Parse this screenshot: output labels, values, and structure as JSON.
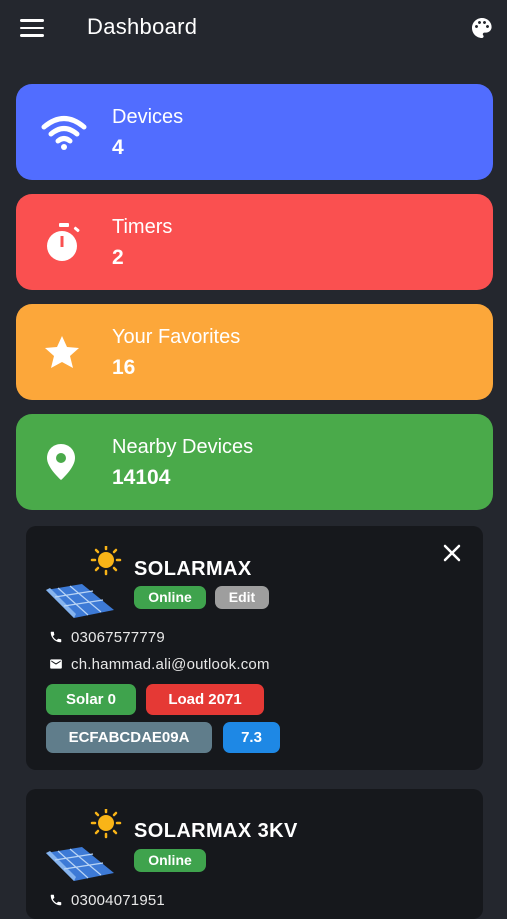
{
  "appbar": {
    "title": "Dashboard",
    "menu_icon": "hamburger-menu-icon",
    "palette_icon": "palette-icon"
  },
  "stats": [
    {
      "label": "Devices",
      "value": "4",
      "color": "#516dff",
      "icon": "wifi-icon"
    },
    {
      "label": "Timers",
      "value": "2",
      "color": "#fa5050",
      "icon": "stopwatch-icon"
    },
    {
      "label": "Your Favorites",
      "value": "16",
      "color": "#fca73a",
      "icon": "star-icon"
    },
    {
      "label": "Nearby Devices",
      "value": "14104",
      "color": "#4aaa4a",
      "icon": "location-pin-icon"
    }
  ],
  "devices": [
    {
      "name": "SOLARMAX",
      "status": "Online",
      "edit_label": "Edit",
      "phone": "03067577779",
      "email": "ch.hammad.ali@outlook.com",
      "solar": "Solar 0",
      "load": "Load 2071",
      "device_id": "ECFABCDAE09A",
      "version": "7.3"
    },
    {
      "name": "SOLARMAX 3KV",
      "status": "Online",
      "phone": "03004071951"
    }
  ],
  "colors": {
    "background": "#24272e",
    "card": "#16181c",
    "online": "#3fa34d",
    "edit": "#9e9e9e",
    "solar": "#3fa34d",
    "load": "#e53935",
    "device_id": "#607d8b",
    "version": "#1e88e5"
  }
}
